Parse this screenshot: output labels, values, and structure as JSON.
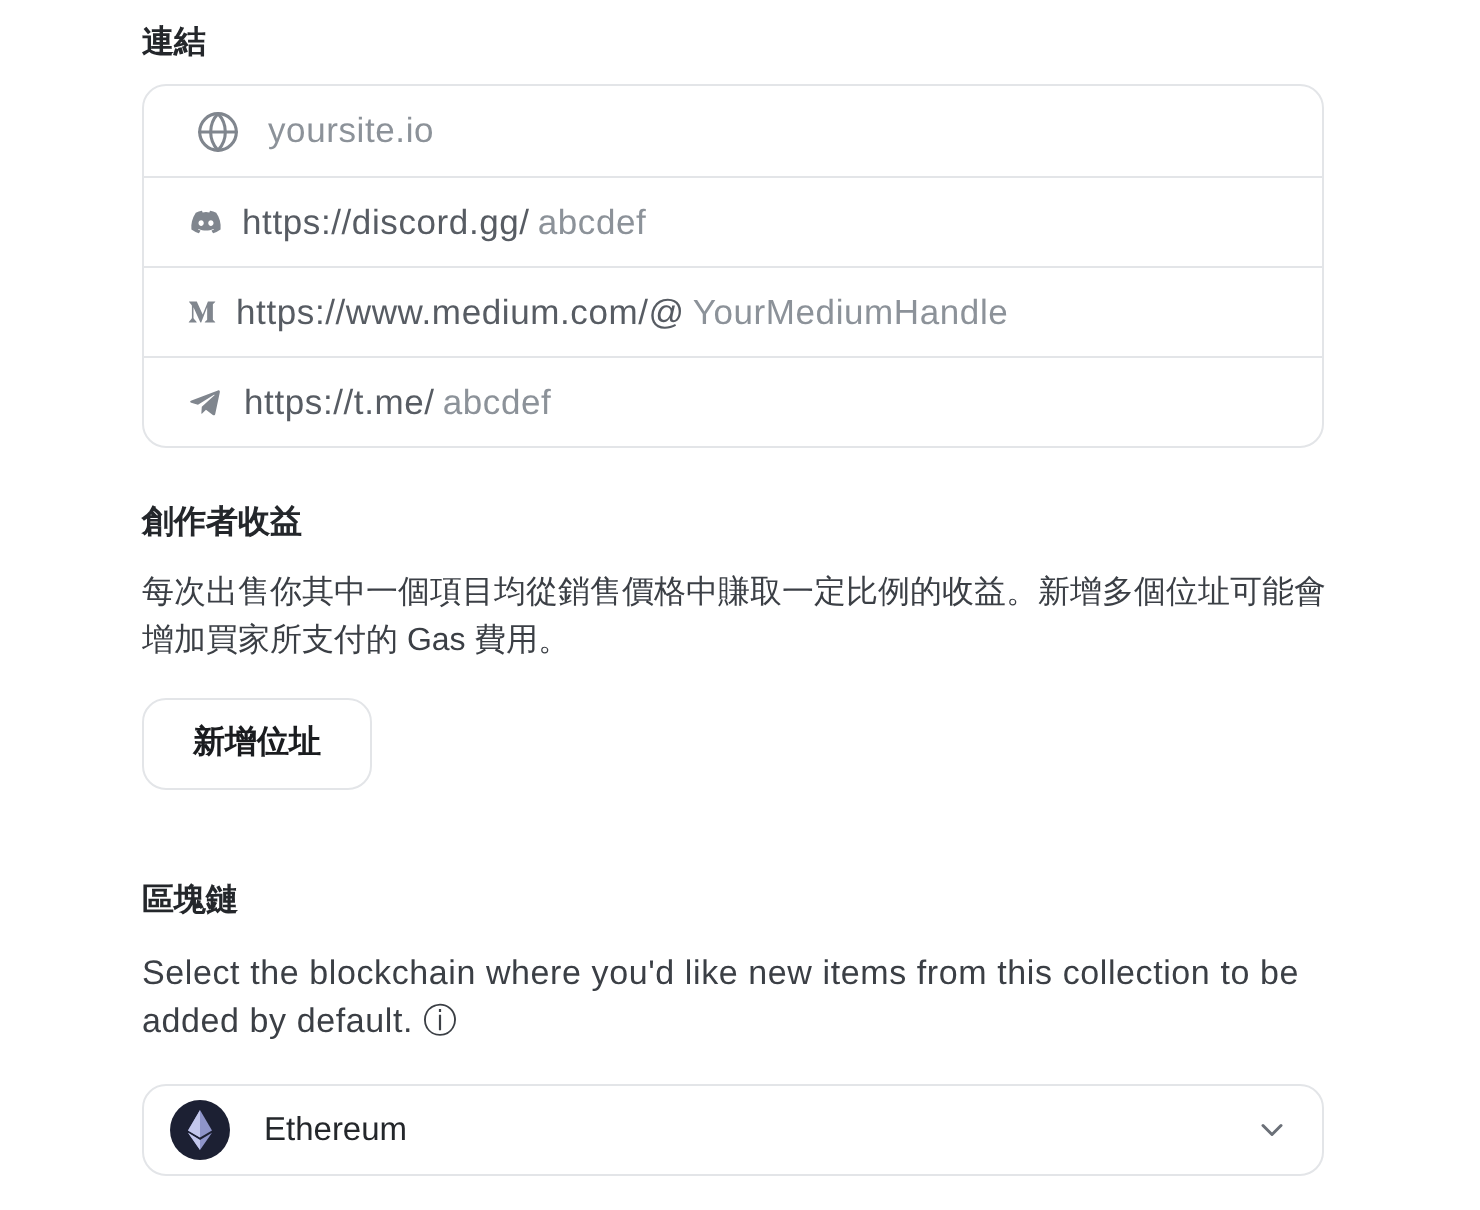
{
  "links": {
    "title": "連結",
    "rows": [
      {
        "kind": "website",
        "placeholder": "yoursite.io"
      },
      {
        "kind": "discord",
        "prefix": "https://discord.gg/",
        "placeholder": "abcdef"
      },
      {
        "kind": "medium",
        "prefix": "https://www.medium.com/@",
        "placeholder": "YourMediumHandle"
      },
      {
        "kind": "telegram",
        "prefix": "https://t.me/",
        "placeholder": "abcdef"
      }
    ]
  },
  "royalties": {
    "title": "創作者收益",
    "description": "每次出售你其中一個項目均從銷售價格中賺取一定比例的收益。新增多個位址可能會增加買家所支付的 Gas 費用。",
    "button": "新增位址"
  },
  "blockchain": {
    "title": "區塊鏈",
    "description": "Select the blockchain where you'd like new items from this collection to be added by default. ⓘ",
    "select": {
      "value": "Ethereum"
    }
  }
}
